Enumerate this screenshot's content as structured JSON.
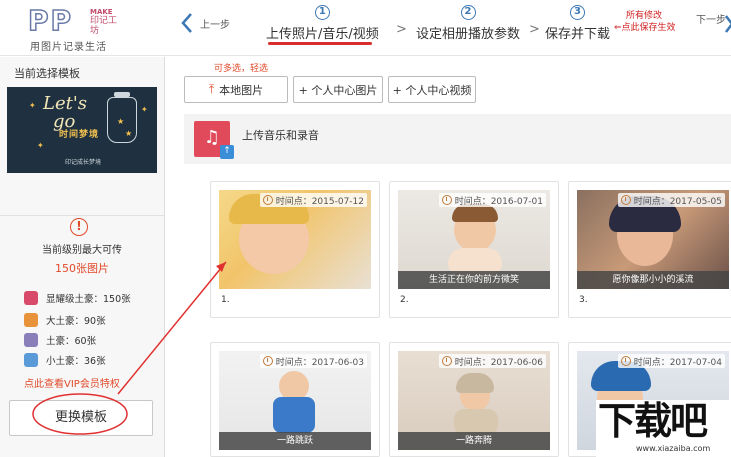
{
  "header": {
    "logo": {
      "main": "PP",
      "make": "MAKE",
      "cn": "印记工坊",
      "tagline": "用图片记录生活"
    },
    "prev_label": "上一步",
    "next_label": "下一步",
    "steps": [
      {
        "num": "1",
        "label": "上传照片/音乐/视频"
      },
      {
        "num": "2",
        "label": "设定相册播放参数"
      },
      {
        "num": "3",
        "label": "保存并下载"
      }
    ],
    "separator": ">",
    "note_line1": "所有修改",
    "note_line2": "点此保存生效"
  },
  "sidebar": {
    "title": "当前选择模板",
    "template": {
      "line1": "Let's",
      "line2": "go",
      "subtitle": "时间梦境",
      "footer": "印记成长梦境"
    },
    "warning_icon": "!",
    "level_text": "当前级别最大可传",
    "level_limit": "150张图片",
    "tiers": [
      {
        "label": "显耀级土豪：150张",
        "color": "#d94a6a"
      },
      {
        "label": "大土豪：90张",
        "color": "#e8923a"
      },
      {
        "label": "土豪：60张",
        "color": "#8a7fb8"
      },
      {
        "label": "小土豪：36张",
        "color": "#5a9ad8"
      }
    ],
    "vip_link": "点此查看VIP会员特权",
    "change_button": "更换模板"
  },
  "main": {
    "multi_hint": "可多选，轻选",
    "buttons": {
      "local": "本地图片",
      "pics": "+ 个人中心图片",
      "vids": "+ 个人中心视频"
    },
    "audio_label": "上传音乐和录音",
    "cards": [
      {
        "time": "时间点：2015-07-12",
        "caption": "",
        "index": "1."
      },
      {
        "time": "时间点：2016-07-01",
        "caption": "生活正在你的前方微笑",
        "index": "2."
      },
      {
        "time": "时间点：2017-05-05",
        "caption": "愿你像那小小的溪流",
        "index": "3."
      },
      {
        "time": "时间点：2017-06-03",
        "caption": "一路跳跃",
        "index": ""
      },
      {
        "time": "时间点：2017-06-06",
        "caption": "一路奔腾",
        "index": ""
      },
      {
        "time": "时间点：2017-07-04",
        "caption": "",
        "index": ""
      }
    ]
  },
  "watermark": {
    "text": "下载吧",
    "url": "www.xiazaiba.com"
  },
  "icons": {
    "prev": "chevron-left-icon",
    "next": "chevron-right-icon",
    "upload": "upload-icon",
    "music": "music-icon",
    "clock": "clock-icon",
    "warning": "warning-icon"
  },
  "colors": {
    "accent_red": "#d92c2c",
    "step_blue": "#3c78b4",
    "hint_red": "#e04a2a"
  }
}
